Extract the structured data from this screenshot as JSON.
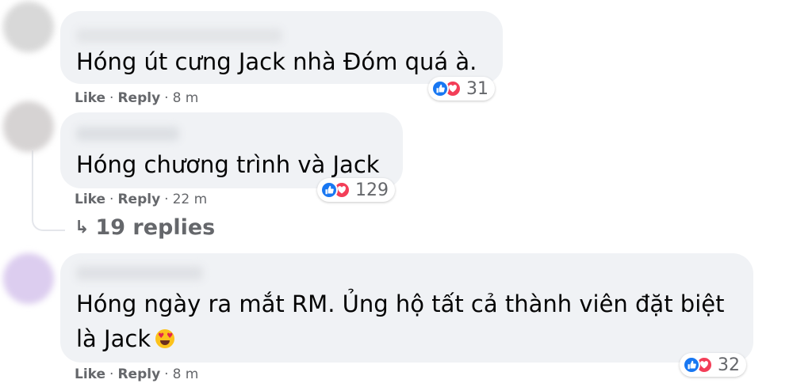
{
  "comments": [
    {
      "text_lines": [
        "Hóng út cưng Jack nhà Đóm quá à."
      ],
      "actions": {
        "like": "Like",
        "reply": "Reply",
        "time": "8 m",
        "sep": "·"
      },
      "reactions": {
        "icons": [
          "like-icon",
          "love-icon"
        ],
        "count": "31"
      }
    },
    {
      "text_lines": [
        "Hóng chương trình và Jack"
      ],
      "actions": {
        "like": "Like",
        "reply": "Reply",
        "time": "22 m",
        "sep": "·"
      },
      "reactions": {
        "icons": [
          "like-icon",
          "love-icon"
        ],
        "count": "129"
      },
      "replies_label": "19 replies"
    },
    {
      "text_lines": [
        "Hóng ngày ra mắt RM. Ủng hộ tất cả thành viên đặt biệt",
        "là Jack"
      ],
      "emoji": "heart-eyes-emoji",
      "actions": {
        "like": "Like",
        "reply": "Reply",
        "time": "8 m",
        "sep": "·"
      },
      "reactions": {
        "icons": [
          "like-icon",
          "love-icon"
        ],
        "count": "32"
      }
    }
  ],
  "colors": {
    "bubble": "#f0f2f5",
    "like": "#1877f2",
    "love": "#f33e58",
    "meta": "#65676b"
  }
}
